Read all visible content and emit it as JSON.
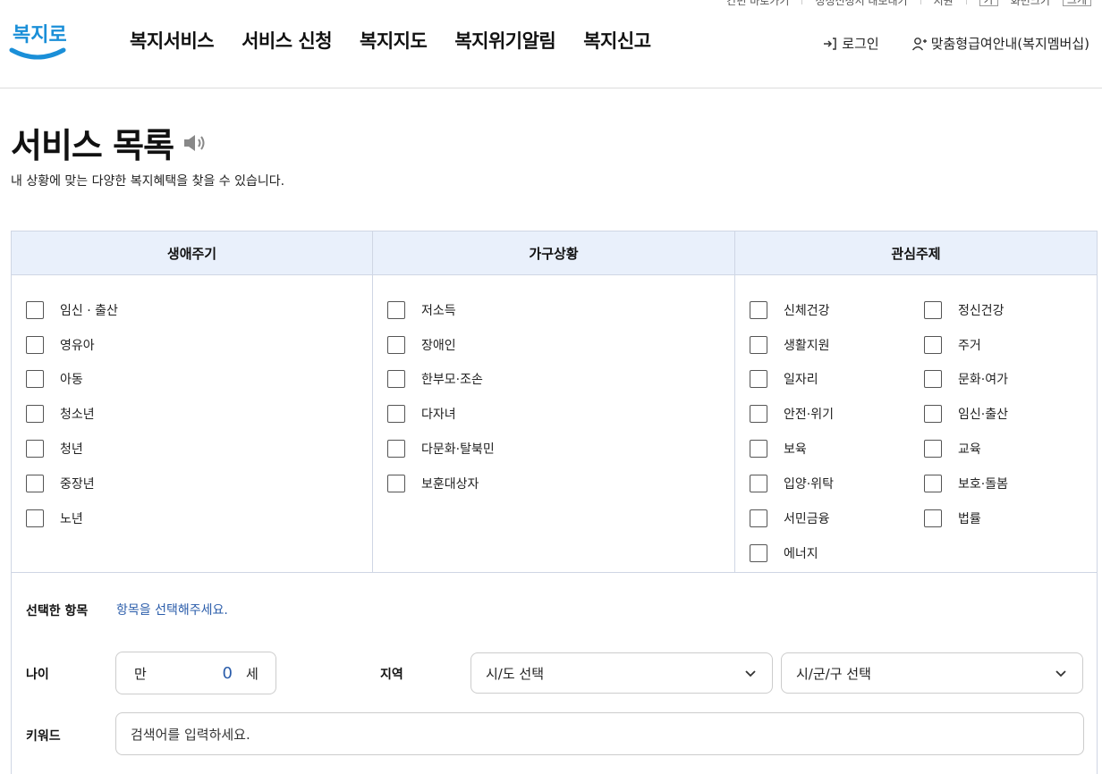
{
  "util": {
    "item1": "간편 바로가기",
    "item2": "정정신청서 내보내기",
    "item3": "지원",
    "box1": "가",
    "item4": "화면크기",
    "box2": "크게"
  },
  "header": {
    "nav": [
      "복지서비스",
      "서비스 신청",
      "복지지도",
      "복지위기알림",
      "복지신고"
    ],
    "login": "로그인",
    "membership": "맞춤형급여안내(복지멤버십)"
  },
  "page": {
    "title": "서비스 목록",
    "subtitle": "내 상황에 맞는 다양한 복지혜택을 찾을 수 있습니다."
  },
  "filters": {
    "col1_header": "생애주기",
    "col2_header": "가구상황",
    "col3_header": "관심주제",
    "lifecycle": [
      "임신 · 출산",
      "영유아",
      "아동",
      "청소년",
      "청년",
      "중장년",
      "노년"
    ],
    "household": [
      "저소득",
      "장애인",
      "한부모·조손",
      "다자녀",
      "다문화·탈북민",
      "보훈대상자"
    ],
    "interest_left": [
      "신체건강",
      "생활지원",
      "일자리",
      "안전·위기",
      "보육",
      "입양·위탁",
      "서민금융",
      "에너지"
    ],
    "interest_right": [
      "정신건강",
      "주거",
      "문화·여가",
      "임신·출산",
      "교육",
      "보호·돌봄",
      "법률"
    ]
  },
  "form": {
    "selected_label": "선택한 항목",
    "selected_hint": "항목을 선택해주세요.",
    "age_label": "나이",
    "age_prefix": "만",
    "age_value": "0",
    "age_suffix": "세",
    "region_label": "지역",
    "sido_placeholder": "시/도 선택",
    "sigungu_placeholder": "시/군/구 선택",
    "keyword_label": "키워드",
    "keyword_placeholder": "검색어를 입력하세요."
  },
  "colors": {
    "brand_blue": "#1a8fd8",
    "header_bg": "#e9f0fb",
    "hint_blue": "#2a5caa"
  }
}
